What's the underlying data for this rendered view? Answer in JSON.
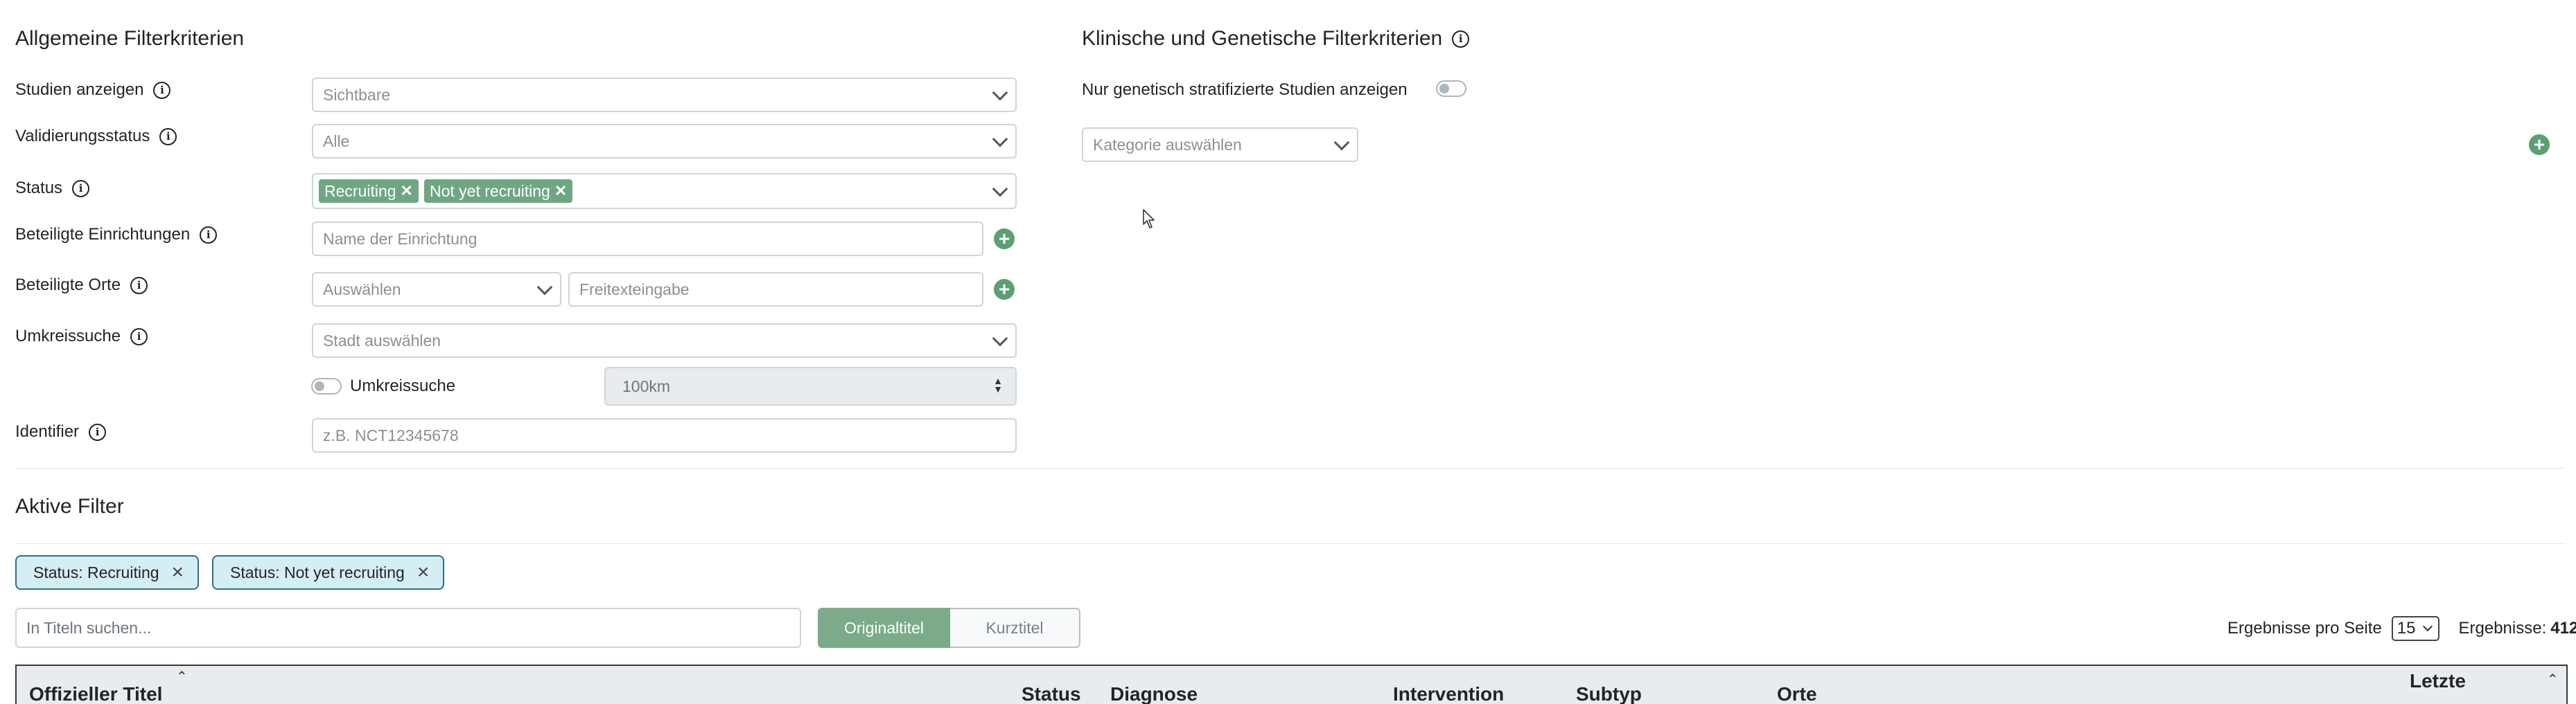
{
  "general": {
    "title": "Allgemeine Filterkriterien",
    "studies_label": "Studien anzeigen",
    "studies_value": "Sichtbare",
    "validation_label": "Validierungsstatus",
    "validation_value": "Alle",
    "status_label": "Status",
    "status_tags": [
      "Recruiting",
      "Not yet recruiting"
    ],
    "institutions_label": "Beteiligte Einrichtungen",
    "institutions_placeholder": "Name der Einrichtung",
    "locations_label": "Beteiligte Orte",
    "locations_select": "Auswählen",
    "locations_placeholder": "Freitexteingabe",
    "radius_label": "Umkreissuche",
    "radius_city": "Stadt auswählen",
    "radius_toggle_label": "Umkreissuche",
    "radius_distance": "100km",
    "identifier_label": "Identifier",
    "identifier_placeholder": "z.B. NCT12345678"
  },
  "clinical": {
    "title": "Klinische und Genetische Filterkriterien",
    "genetic_toggle_label": "Nur genetisch stratifizierte Studien anzeigen",
    "category_placeholder": "Kategorie auswählen"
  },
  "active_filters": {
    "title": "Aktive Filter",
    "chips": [
      "Status: Recruiting",
      "Status: Not yet recruiting"
    ]
  },
  "results": {
    "search_placeholder": "In Titeln suchen...",
    "title_mode_original": "Originaltitel",
    "title_mode_short": "Kurztitel",
    "per_page_label": "Ergebnisse pro Seite",
    "per_page_value": "15",
    "count_label": "Ergebnisse:",
    "count_value": "412"
  },
  "table": {
    "columns": [
      "Offizieller Titel",
      "Status",
      "Diagnose",
      "Intervention",
      "Subtyp",
      "Orte",
      "Letzte"
    ]
  },
  "colors": {
    "accent_green": "#6fa783",
    "chip_background": "#d5eef3",
    "chip_border": "#2f6f8a"
  },
  "icons": [
    "info-icon",
    "chevron-down-icon",
    "plus-icon",
    "close-icon",
    "sort-icon",
    "mouse-cursor-icon"
  ]
}
